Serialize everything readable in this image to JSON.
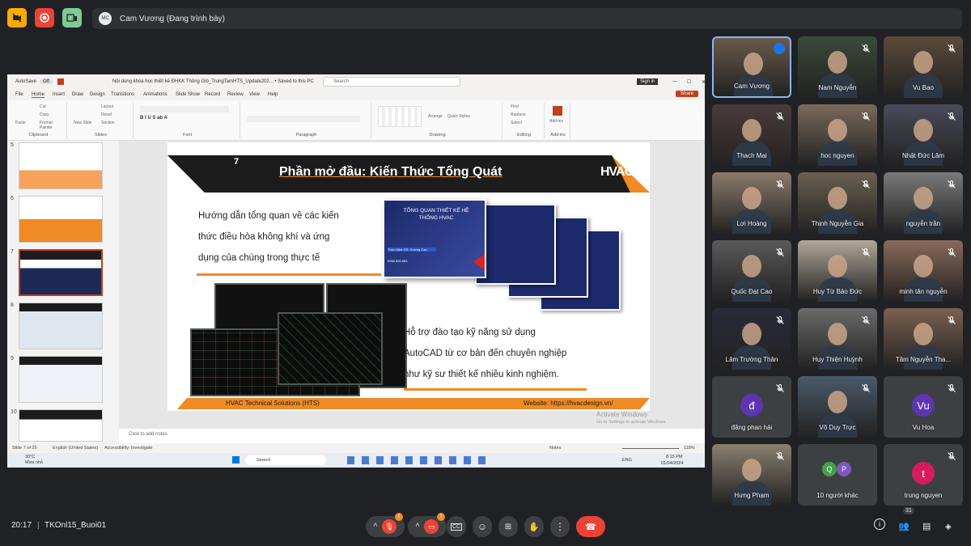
{
  "meeting": {
    "presenter_initials": "MC",
    "presenter_label": "Cam Vương (Đang trình bày)",
    "time": "20:17",
    "meeting_code": "TKOnl15_Buoi01",
    "participant_count": "31"
  },
  "powerpoint": {
    "autosave": "AutoSave",
    "autosave_state": "Off",
    "doc_title": "Nội dung khóa học thiết kế ĐHKK Thông Gió_TrungTamHTS_Update202... • Saved to this PC",
    "search_placeholder": "Search",
    "signin": "Sign in",
    "menu": [
      "File",
      "Home",
      "Insert",
      "Draw",
      "Design",
      "Transitions",
      "Animations",
      "Slide Show",
      "Record",
      "Review",
      "View",
      "Help"
    ],
    "share": "Share",
    "ribbon_groups": [
      "Clipboard",
      "Slides",
      "Font",
      "Paragraph",
      "Drawing",
      "Editing",
      "Add-ins"
    ],
    "ribbon_items": {
      "paste": "Paste",
      "cut": "Cut",
      "copy": "Copy",
      "format_painter": "Format Painter",
      "new_slide": "New Slide",
      "layout": "Layout",
      "reset": "Reset",
      "section": "Section",
      "arrange": "Arrange",
      "quick_styles": "Quick Styles",
      "find": "Find",
      "replace": "Replace",
      "select": "Select",
      "addins": "Add-ins"
    },
    "thumb_numbers": [
      "5",
      "6",
      "7",
      "8",
      "9",
      "10"
    ],
    "notes_placeholder": "Click to add notes",
    "status_slide": "Slide 7 of 25",
    "status_lang": "English (United States)",
    "status_access": "Accessibility: Investigate",
    "status_notes": "Notes",
    "zoom": "118%",
    "activate_title": "Activate Windows",
    "activate_sub": "Go to Settings to activate Windows."
  },
  "slide": {
    "number": "7",
    "title": "Phần mở đầu: Kiến Thức Tổng Quát",
    "logo": "HVAC",
    "text1_lines": [
      "Hướng dẫn tổng quan về các kiến",
      "thức điều hòa không khí và ứng",
      "dụng của chúng trong thực tế"
    ],
    "text2_lines": [
      "Hỗ trợ đào tạo kỹ năng sử dụng",
      "AutoCAD từ cơ bản đến chuyên nghiệp",
      "như kỹ sư thiết kế nhiều kinh nghiệm."
    ],
    "book_title": "TỔNG QUAN THIẾT KẾ HỆ THỐNG HVAC",
    "book_presenter": "Thực hiện: KS. Vương Cao",
    "book_phone": "0966.890.883",
    "footer_left": "HVAC Technical Solutions (HTS)",
    "footer_right": "Website: https://hvacdesign.vn/"
  },
  "taskbar": {
    "weather_temp": "30°C",
    "weather_desc": "Mưa nhỏ",
    "search": "Search",
    "lang": "ENG",
    "clock_time": "8:15 PM",
    "clock_date": "01/04/2024"
  },
  "participants": [
    {
      "name": "Cam Vương",
      "type": "video",
      "active": true
    },
    {
      "name": "Nam Nguyễn",
      "type": "video"
    },
    {
      "name": "Vu Bao",
      "type": "video"
    },
    {
      "name": "Thach Mai",
      "type": "video"
    },
    {
      "name": "hoc nguyen",
      "type": "video"
    },
    {
      "name": "Nhật Đức Lâm",
      "type": "video"
    },
    {
      "name": "Lợi Hoàng",
      "type": "video"
    },
    {
      "name": "Thịnh Nguyễn Gia",
      "type": "video"
    },
    {
      "name": "nguyễn trần",
      "type": "video"
    },
    {
      "name": "Quốc Đạt Cao",
      "type": "video"
    },
    {
      "name": "Huy Từ Bảo Đức",
      "type": "video"
    },
    {
      "name": "minh tân nguyễn",
      "type": "video"
    },
    {
      "name": "Lâm Trường Thân",
      "type": "video"
    },
    {
      "name": "Huy Thiện Huỳnh",
      "type": "video"
    },
    {
      "name": "Tâm Nguyễn Tha...",
      "type": "video"
    },
    {
      "name": "đăng phan hải",
      "type": "initial",
      "initial": "đ",
      "color": "#5e35b1"
    },
    {
      "name": "Võ Duy Trực",
      "type": "video"
    },
    {
      "name": "Vu Hoa",
      "type": "initial",
      "initial": "Vu",
      "color": "#5e35b1"
    },
    {
      "name": "Hưng Phạm",
      "type": "video"
    },
    {
      "name": "10 người khác",
      "type": "group",
      "initial": "Q",
      "initial2": "P"
    },
    {
      "name": "trung nguyen",
      "type": "initial",
      "initial": "t",
      "color": "#d81b60"
    }
  ],
  "controls": {
    "mic_badge": "!",
    "cam_badge": "!"
  },
  "colors": {
    "accent_orange": "#f0861f",
    "end_call": "#ea4335",
    "slide_dark": "#1c1c1c"
  }
}
